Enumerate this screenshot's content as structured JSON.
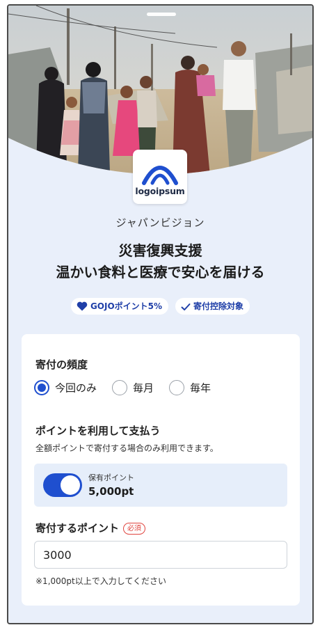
{
  "campaign": {
    "hero_image": "refugee-family-photo",
    "logo_text": "logoipsum",
    "organization": "ジャパンビジョン",
    "title_line1": "災害復興支援",
    "title_line2": "温かい食料と医療で安心を届ける",
    "badges": [
      {
        "icon": "heart-icon",
        "label": "GOJOポイント5%"
      },
      {
        "icon": "check-icon",
        "label": "寄付控除対象"
      }
    ]
  },
  "form": {
    "frequency": {
      "label": "寄付の頻度",
      "options": [
        {
          "label": "今回のみ",
          "selected": true
        },
        {
          "label": "毎月",
          "selected": false
        },
        {
          "label": "毎年",
          "selected": false
        }
      ]
    },
    "points_payment": {
      "label": "ポイントを利用して支払う",
      "hint": "全額ポイントで寄付する場合のみ利用できます。",
      "toggle_on": true,
      "balance_caption": "保有ポイント",
      "balance_value": "5,000pt"
    },
    "donation_points": {
      "label": "寄付するポイント",
      "required_badge": "必須",
      "value": "3000",
      "note": "※1,000pt以上で入力してください"
    }
  },
  "colors": {
    "accent": "#1f4fcf",
    "background": "#e9effa",
    "required": "#e0443e"
  }
}
